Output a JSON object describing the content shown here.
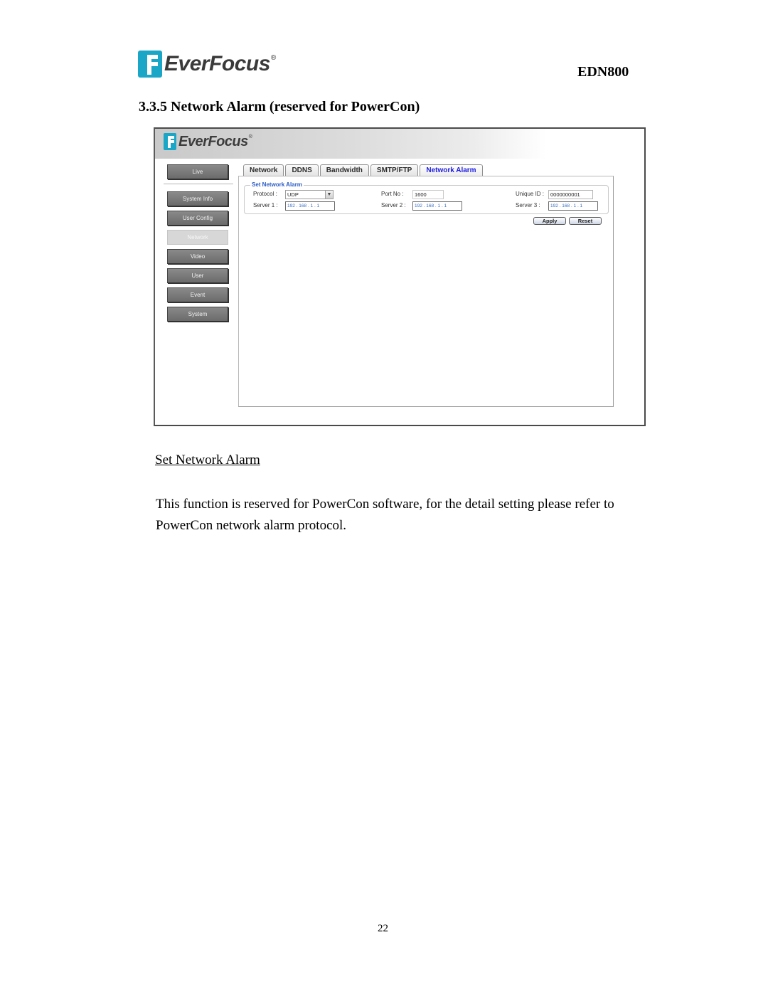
{
  "header": {
    "brand": "EverFocus",
    "registered_mark": "®",
    "model": "EDN800"
  },
  "section": {
    "title": "3.3.5 Network Alarm (reserved for PowerCon)"
  },
  "screenshot": {
    "brand": "EverFocus",
    "registered_mark": "®",
    "sidebar": {
      "items": [
        {
          "label": "Live",
          "active": false
        },
        {
          "label": "System Info",
          "active": false
        },
        {
          "label": "User Config",
          "active": false
        },
        {
          "label": "Network",
          "active": true
        },
        {
          "label": "Video",
          "active": false
        },
        {
          "label": "User",
          "active": false
        },
        {
          "label": "Event",
          "active": false
        },
        {
          "label": "System",
          "active": false
        }
      ]
    },
    "tabs": [
      {
        "label": "Network",
        "active": false
      },
      {
        "label": "DDNS",
        "active": false
      },
      {
        "label": "Bandwidth",
        "active": false
      },
      {
        "label": "SMTP/FTP",
        "active": false
      },
      {
        "label": "Network Alarm",
        "active": true
      }
    ],
    "form": {
      "legend": "Set Network Alarm",
      "protocol_label": "Protocol :",
      "protocol_value": "UDP",
      "port_label": "Port No :",
      "port_value": "1600",
      "unique_id_label": "Unique ID :",
      "unique_id_value": "0000000001",
      "server1_label": "Server 1 :",
      "server1_value": "192 . 168 .  1  .  1",
      "server2_label": "Server 2 :",
      "server2_value": "192 . 168 .  1  .  1",
      "server3_label": "Server 3 :",
      "server3_value": "192 . 168 .  1  .  1",
      "apply_label": "Apply",
      "reset_label": "Reset"
    }
  },
  "body": {
    "subheading": "Set Network Alarm",
    "paragraph": "This function is reserved for PowerCon software, for the detail setting please refer to PowerCon network alarm protocol."
  },
  "footer": {
    "page_number": "22"
  }
}
